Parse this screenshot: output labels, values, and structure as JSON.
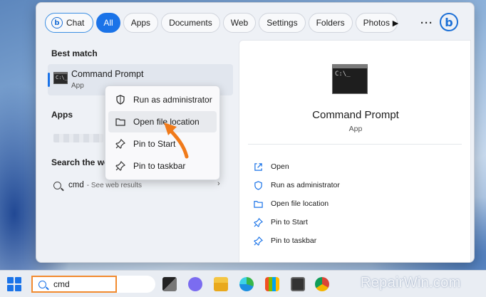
{
  "search_menu": {
    "tabs": [
      {
        "label": "Chat"
      },
      {
        "label": "All"
      },
      {
        "label": "Apps"
      },
      {
        "label": "Documents"
      },
      {
        "label": "Web"
      },
      {
        "label": "Settings"
      },
      {
        "label": "Folders"
      },
      {
        "label": "Photos"
      }
    ],
    "active_tab": "All",
    "more_label": "···",
    "bing_icon_glyph": "b"
  },
  "results": {
    "best_match_heading": "Best match",
    "best_match": {
      "title": "Command Prompt",
      "subtitle": "App"
    },
    "apps_heading": "Apps",
    "search_web_heading": "Search the web",
    "web_query": "cmd",
    "web_hint": "- See web results"
  },
  "context_menu": {
    "items": [
      {
        "label": "Run as administrator",
        "icon": "shield-icon"
      },
      {
        "label": "Open file location",
        "icon": "folder-icon"
      },
      {
        "label": "Pin to Start",
        "icon": "pin-icon"
      },
      {
        "label": "Pin to taskbar",
        "icon": "pin-icon"
      }
    ],
    "highlighted": "Open file location"
  },
  "details_pane": {
    "title": "Command Prompt",
    "subtitle": "App",
    "actions": [
      {
        "label": "Open",
        "icon": "open-external-icon"
      },
      {
        "label": "Run as administrator",
        "icon": "shield-icon"
      },
      {
        "label": "Open file location",
        "icon": "folder-icon"
      },
      {
        "label": "Pin to Start",
        "icon": "pin-icon"
      },
      {
        "label": "Pin to taskbar",
        "icon": "pin-icon"
      }
    ]
  },
  "taskbar": {
    "search_value": "cmd",
    "icons": [
      "task-view-icon",
      "teams-chat-icon",
      "file-explorer-icon",
      "edge-icon",
      "store-icon",
      "calculator-icon",
      "chrome-icon"
    ]
  },
  "watermark": "RepairWin.com",
  "colors": {
    "accent": "#1a73e8",
    "highlight_box": "#f28a2e",
    "arrow": "#f07a1a"
  }
}
